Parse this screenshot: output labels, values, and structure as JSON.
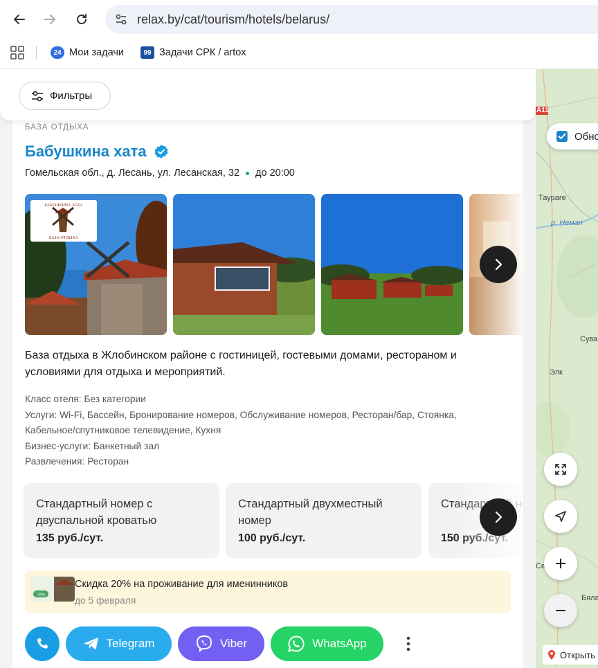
{
  "browser": {
    "url": "relax.by/cat/tourism/hotels/belarus/",
    "bookmarks": [
      {
        "badge": "24",
        "label": "Мои задачи",
        "color": "#2f6fe0"
      },
      {
        "badge": "99",
        "label": "Задачи СРК / artox",
        "color": "#1d4f9c"
      }
    ]
  },
  "filters": {
    "label": "Фильтры"
  },
  "listing": {
    "type": "БАЗА ОТДЫХА",
    "name": "Бабушкина хата",
    "address": "Гомельская обл., д. Лесань, ул. Лесанская, 32",
    "hours": "до 20:00",
    "logo_text_top": "БАБУШКИНА ХАТА",
    "logo_text_bottom": "БАЗА ОТДЫХА",
    "description": "База отдыха в Жлобинском районе с гостиницей, гостевыми домами, рестораном и условиями для отдыха и мероприятий.",
    "details": [
      "Класс отеля: Без категории",
      "Услуги: Wi-Fi, Бассейн, Бронирование номеров, Обслуживание номеров, Ресторан/бар, Стоянка, Кабельное/спутниковое телевидение, Кухня",
      "Бизнес-услуги: Банкетный зал",
      "Развлечения: Ресторан"
    ],
    "rooms": [
      {
        "title": "Стандартный номер с двуспальной кроватью",
        "price": "135 руб./сут."
      },
      {
        "title": "Стандартный двухместный номер",
        "price": "100 руб./сут."
      },
      {
        "title": "Стандартный номер",
        "price": "150 руб./сут."
      }
    ],
    "promo": {
      "title": "Скидка 20% на проживание для именинников",
      "date": "до 5 февраля",
      "thumb_badge": "-20%"
    },
    "contacts": {
      "telegram": "Telegram",
      "viber": "Viber",
      "whatsapp": "WhatsApp"
    }
  },
  "map": {
    "checkbox_label": "Обно",
    "labels": [
      "A11",
      "Таураге",
      "р. Неман",
      "Сува",
      "Элк",
      "Се",
      "Бяла"
    ],
    "open_label": "Открыть"
  },
  "colors": {
    "accent": "#1a86c9",
    "telegram": "#2aabee",
    "viber": "#7360f2",
    "whatsapp": "#25d366",
    "phone": "#1a9ee3"
  }
}
